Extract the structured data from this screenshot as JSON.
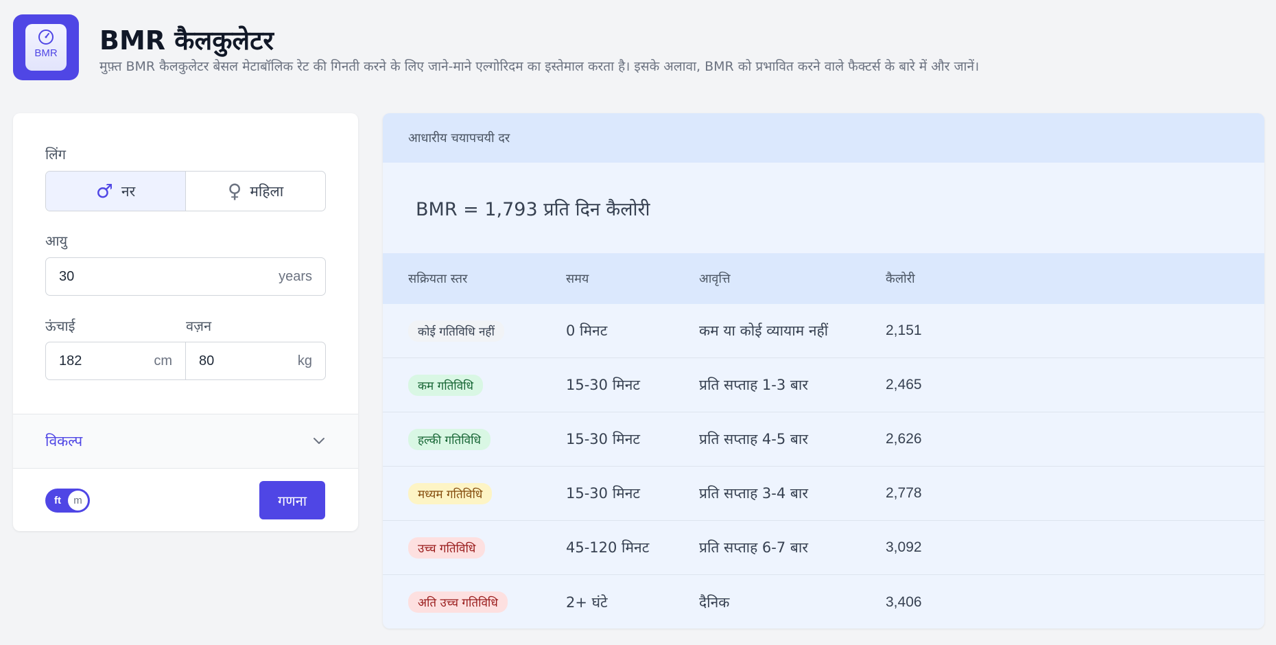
{
  "header": {
    "icon_text": "BMR",
    "title": "BMR कैलकुलेटर",
    "subtitle": "मुफ़्त BMR कैलकुलेटर बेसल मेटाबॉलिक रेट की गिनती करने के लिए जाने-माने एल्गोरिदम का इस्तेमाल करता है। इसके अलावा, BMR को प्रभावित करने वाले फैक्टर्स के बारे में और जानें।"
  },
  "form": {
    "gender_label": "लिंग",
    "male_label": "नर",
    "female_label": "महिला",
    "selected_gender": "male",
    "age_label": "आयु",
    "age_value": "30",
    "age_unit": "years",
    "height_label": "ऊंचाई",
    "height_value": "182",
    "height_unit": "cm",
    "weight_label": "वज़न",
    "weight_value": "80",
    "weight_unit": "kg",
    "options_label": "विकल्प",
    "unit_toggle": {
      "left": "ft",
      "right": "m"
    },
    "calculate_label": "गणना"
  },
  "result": {
    "heading": "आधारीय चयापचयी दर",
    "bmr_text": "BMR = 1,793 प्रति दिन कैलोरी",
    "table": {
      "headers": [
        "सक्रियता स्तर",
        "समय",
        "आवृत्ति",
        "कैलोरी"
      ],
      "rows": [
        {
          "level": "कोई गतिविधि नहीं",
          "time": "0 मिनट",
          "frequency": "कम या कोई व्यायाम नहीं",
          "calories": "2,151"
        },
        {
          "level": "कम गतिविधि",
          "time": "15-30 मिनट",
          "frequency": "प्रति सप्ताह 1-3 बार",
          "calories": "2,465"
        },
        {
          "level": "हल्की गतिविधि",
          "time": "15-30 मिनट",
          "frequency": "प्रति सप्ताह 4-5 बार",
          "calories": "2,626"
        },
        {
          "level": "मध्यम गतिविधि",
          "time": "15-30 मिनट",
          "frequency": "प्रति सप्ताह 3-4 बार",
          "calories": "2,778"
        },
        {
          "level": "उच्च गतिविधि",
          "time": "45-120 मिनट",
          "frequency": "प्रति सप्ताह 6-7 बार",
          "calories": "3,092"
        },
        {
          "level": "अति उच्च गतिविधि",
          "time": "2+ घंटे",
          "frequency": "दैनिक",
          "calories": "3,406"
        }
      ]
    }
  },
  "colors": {
    "accent": "#4f46e5",
    "page_bg": "#f3f4f6",
    "result_header_bg": "#dbe8fd"
  }
}
